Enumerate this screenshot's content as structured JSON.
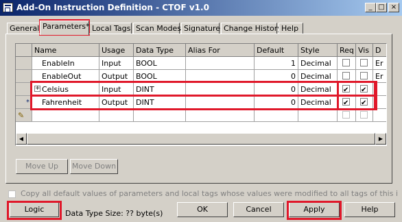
{
  "window": {
    "title": "Add-On Instruction Definition - CTOF v1.0",
    "minimize": "_",
    "maximize": "□",
    "close": "×"
  },
  "tabs": [
    {
      "label": "General"
    },
    {
      "label": "Parameters*",
      "active": true
    },
    {
      "label": "Local Tags"
    },
    {
      "label": "Scan Modes"
    },
    {
      "label": "Signature"
    },
    {
      "label": "Change History"
    },
    {
      "label": "Help"
    }
  ],
  "table": {
    "headers": [
      "Name",
      "Usage",
      "Data Type",
      "Alias For",
      "Default",
      "Style",
      "Req",
      "Vis",
      "D"
    ],
    "rows": [
      {
        "name": "EnableIn",
        "usage": "Input",
        "type": "BOOL",
        "alias": "",
        "default": "1",
        "style": "Decimal",
        "req": false,
        "vis": false,
        "desc": "Er"
      },
      {
        "name": "EnableOut",
        "usage": "Output",
        "type": "BOOL",
        "alias": "",
        "default": "0",
        "style": "Decimal",
        "req": false,
        "vis": false,
        "desc": "Er"
      },
      {
        "name": "Celsius",
        "usage": "Input",
        "type": "DINT",
        "alias": "",
        "default": "0",
        "style": "Decimal",
        "req": true,
        "vis": true,
        "desc": ""
      },
      {
        "name": "Fahrenheit",
        "usage": "Output",
        "type": "DINT",
        "alias": "",
        "default": "0",
        "style": "Decimal",
        "req": true,
        "vis": true,
        "desc": ""
      }
    ],
    "expand_glyph": "+",
    "edit_glyph": "✎",
    "current_row_glyph": "*"
  },
  "buttons": {
    "move_up": "Move Up",
    "move_down": "Move Down",
    "logic": "Logic",
    "ok": "OK",
    "cancel": "Cancel",
    "apply": "Apply",
    "help": "Help"
  },
  "copy_checkbox_label": "Copy all default values of parameters and local tags whose values were modified to all tags of this instruction type",
  "data_type_size": "Data Type Size: ?? byte(s)",
  "scroll_left": "◀",
  "scroll_right": "▶",
  "highlight_color": "#e0182a"
}
